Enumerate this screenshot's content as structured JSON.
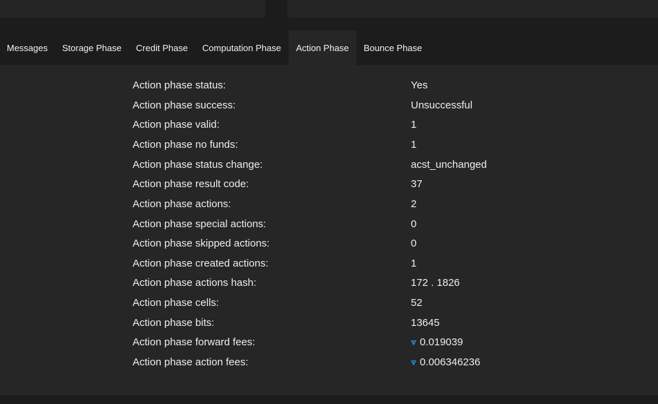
{
  "tabs": [
    {
      "label": "Messages",
      "active": false
    },
    {
      "label": "Storage Phase",
      "active": false
    },
    {
      "label": "Credit Phase",
      "active": false
    },
    {
      "label": "Computation Phase",
      "active": false
    },
    {
      "label": "Action Phase",
      "active": true
    },
    {
      "label": "Bounce Phase",
      "active": false
    }
  ],
  "action_phase": {
    "rows": [
      {
        "label": "Action phase status:",
        "value": "Yes"
      },
      {
        "label": "Action phase success:",
        "value": "Unsuccessful"
      },
      {
        "label": "Action phase valid:",
        "value": "1"
      },
      {
        "label": "Action phase no funds:",
        "value": "1"
      },
      {
        "label": "Action phase status change:",
        "value": "acst_unchanged"
      },
      {
        "label": "Action phase result code:",
        "value": "37"
      },
      {
        "label": "Action phase actions:",
        "value": "2"
      },
      {
        "label": "Action phase special actions:",
        "value": "0"
      },
      {
        "label": "Action phase skipped actions:",
        "value": "0"
      },
      {
        "label": "Action phase created actions:",
        "value": "1"
      },
      {
        "label": "Action phase actions hash:",
        "value": "172 . 1826"
      },
      {
        "label": "Action phase cells:",
        "value": "52"
      },
      {
        "label": "Action phase bits:",
        "value": "13645"
      },
      {
        "label": "Action phase forward fees:",
        "value": "0.019039",
        "icon": "ton-currency-icon"
      },
      {
        "label": "Action phase action fees:",
        "value": "0.006346236",
        "icon": "ton-currency-icon"
      }
    ]
  },
  "colors": {
    "background": "#1c1c1c",
    "panel": "#262626",
    "text": "#eeeeee",
    "ton_icon": "#2f8fd8"
  }
}
